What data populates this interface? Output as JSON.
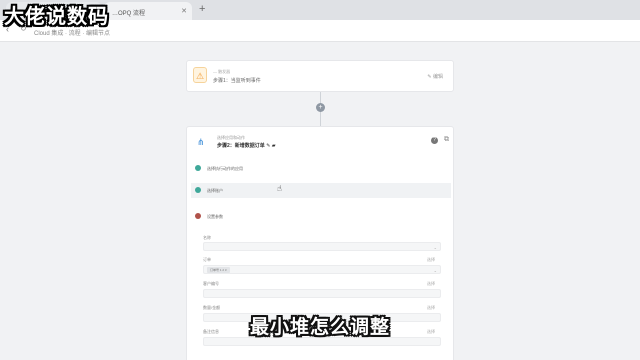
{
  "browser": {
    "tabs": [
      {
        "label": "…Ola | 腾讯云"
      },
      {
        "label": "…OPQ 流程"
      }
    ],
    "new_tab_symbol": "+",
    "url": "Cloud 集成 · 流程 · 编辑节点"
  },
  "icons": {
    "back": "arrow-left-icon",
    "reload": "reload-icon",
    "trigger": "trigger-warning-icon",
    "branch": "branch-icon",
    "help": "help-icon",
    "copy": "copy-icon",
    "cursor": "mouse-cursor-icon"
  },
  "watermark": "大佬说数码",
  "subtitle": "最小堆怎么调整",
  "trigger_card": {
    "caption": "— 触发器",
    "title": "步骤1：当监听到事件",
    "edit_label": "编辑",
    "icon_glyph": "⚠"
  },
  "add_step_symbol": "+",
  "action_card": {
    "caption": "选择应用和动作",
    "title": "步骤2：新增数据订单",
    "options": [
      {
        "label": "选择执行动作的应用",
        "color": "#3fa89a"
      },
      {
        "label": "选择账户",
        "color": "#3fa89a"
      },
      {
        "label": "设置参数",
        "color": "#b0524a"
      }
    ],
    "fields": [
      {
        "label": "名称",
        "right": ""
      },
      {
        "label": "订单",
        "right": "选择",
        "tag": "订单号 1 2 3"
      },
      {
        "label": "客户编号",
        "right": "选择"
      },
      {
        "label": "数量/金额",
        "right": "选择"
      },
      {
        "label": "备注信息",
        "right": "选择"
      }
    ]
  },
  "colors": {
    "accent": "#3a8bd6",
    "trigger": "#f29d38"
  }
}
